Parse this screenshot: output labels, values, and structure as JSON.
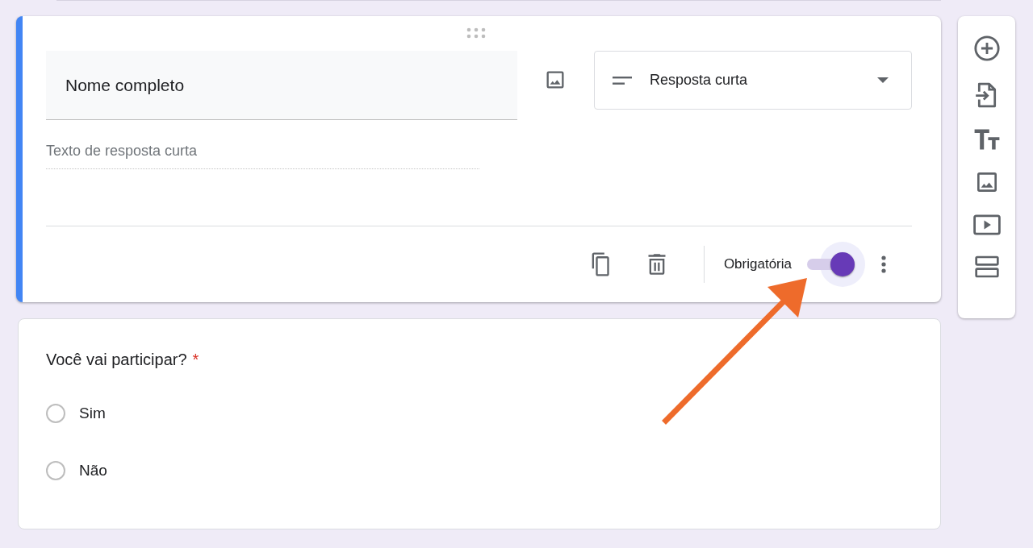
{
  "question_editor": {
    "title": "Nome completo",
    "question_type": "Resposta curta",
    "answer_placeholder": "Texto de resposta curta",
    "required_toggle": {
      "label": "Obrigatória",
      "on": true
    }
  },
  "question_card": {
    "title": "Você vai participar?",
    "required_mark": "*",
    "options": [
      {
        "label": "Sim",
        "selected": false
      },
      {
        "label": "Não",
        "selected": false
      }
    ]
  }
}
